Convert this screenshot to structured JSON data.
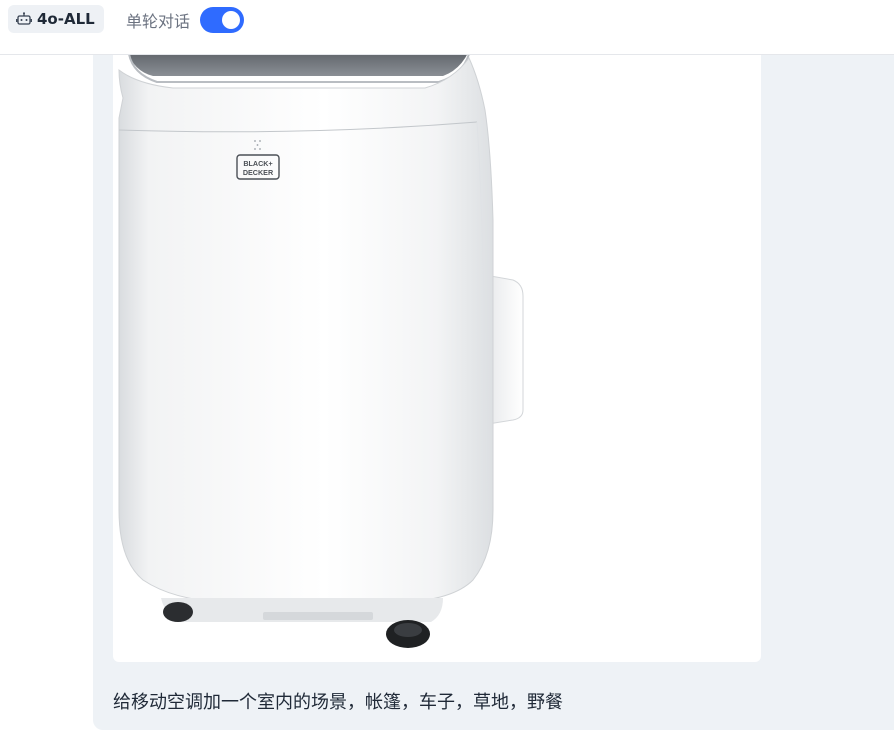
{
  "header": {
    "model_name": "4o-ALL",
    "model_icon": "robot-icon",
    "single_turn_label": "单轮对话",
    "single_turn_enabled": true
  },
  "message": {
    "image": {
      "subject": "portable air conditioner",
      "brand_logo_line1": "BLACK+",
      "brand_logo_line2": "DECKER"
    },
    "prompt_text": "给移动空调加一个室内的场景，帐篷，车子，草地，野餐"
  },
  "colors": {
    "accent": "#2f6bff",
    "bubble_bg": "#eef2f6",
    "chip_bg": "#eef1f5"
  }
}
